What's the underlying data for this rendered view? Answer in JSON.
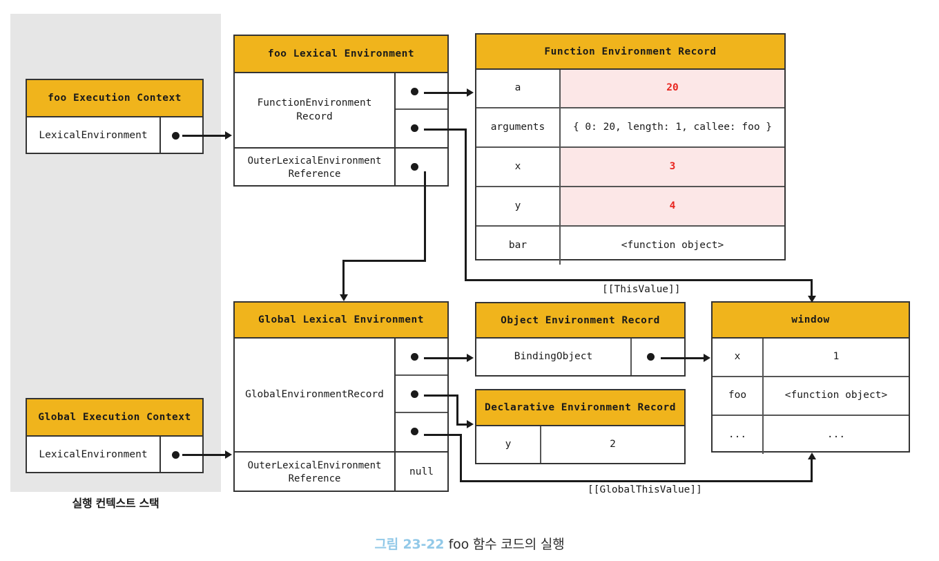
{
  "figure": {
    "number_label": "그림 23-22",
    "title": "foo 함수 코드의 실행",
    "accent_color": "#92C9E8"
  },
  "colors": {
    "header_yellow": "#F0B41C",
    "highlight_pink": "#FCE7E7",
    "value_red": "#E8251F",
    "stack_gray": "#E6E6E6",
    "stroke": "#333333"
  },
  "stack": {
    "caption": "실행 컨텍스트 스택",
    "contexts": [
      {
        "title": "foo Execution Context",
        "field_label": "LexicalEnvironment",
        "pointer": "pointer-dot"
      },
      {
        "title": "Global Execution Context",
        "field_label": "LexicalEnvironment",
        "pointer": "pointer-dot"
      }
    ]
  },
  "foo_lexical_environment": {
    "title": "foo Lexical Environment",
    "rows": [
      {
        "label": "FunctionEnvironment\nRecord",
        "slots": 2
      },
      {
        "label": "OuterLexicalEnvironment\nReference",
        "slots": 1
      }
    ]
  },
  "function_environment_record": {
    "title": "Function Environment Record",
    "columns": [
      "binding",
      "value"
    ],
    "rows": [
      {
        "binding": "a",
        "value": "20",
        "highlight": true
      },
      {
        "binding": "arguments",
        "value": "{ 0: 20, length: 1, callee: foo }",
        "highlight": false
      },
      {
        "binding": "x",
        "value": "3",
        "highlight": true
      },
      {
        "binding": "y",
        "value": "4",
        "highlight": true
      },
      {
        "binding": "bar",
        "value": "<function object>",
        "highlight": false
      }
    ]
  },
  "global_lexical_environment": {
    "title": "Global Lexical Environment",
    "rows": [
      {
        "label": "GlobalEnvironmentRecord",
        "slots": 3,
        "value": ""
      },
      {
        "label": "OuterLexicalEnvironment\nReference",
        "slots": 1,
        "value": "null"
      }
    ]
  },
  "object_environment_record": {
    "title": "Object Environment Record",
    "field_label": "BindingObject"
  },
  "declarative_environment_record": {
    "title": "Declarative Environment Record",
    "rows": [
      {
        "binding": "y",
        "value": "2"
      }
    ]
  },
  "window_object": {
    "title": "window",
    "rows": [
      {
        "binding": "x",
        "value": "1"
      },
      {
        "binding": "foo",
        "value": "<function object>"
      },
      {
        "binding": "...",
        "value": "..."
      }
    ]
  },
  "edge_labels": {
    "this_value": "[[ThisValue]]",
    "global_this_value": "[[GlobalThisValue]]"
  }
}
